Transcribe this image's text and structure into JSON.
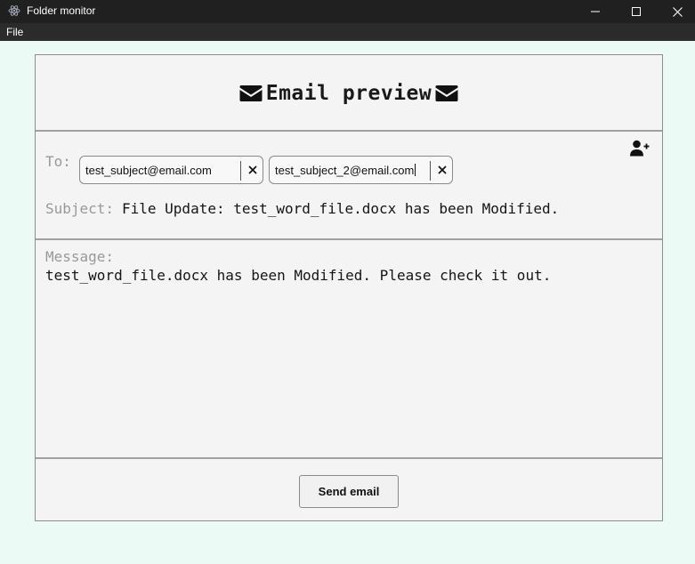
{
  "window": {
    "title": "Folder monitor",
    "app_icon": "electron-icon",
    "controls": {
      "minimize": "minimize-icon",
      "maximize": "maximize-icon",
      "close": "close-icon"
    }
  },
  "menubar": {
    "items": [
      {
        "label": "File"
      }
    ]
  },
  "card": {
    "header": {
      "title": "Email preview",
      "icon": "envelope-icon"
    },
    "recipients": {
      "to_label": "To:",
      "chips": [
        {
          "email": "test_subject@email.com",
          "clear_icon": "x-icon"
        },
        {
          "email": "test_subject_2@email.com",
          "clear_icon": "x-icon",
          "editing": true
        }
      ],
      "add_icon": "add-user-icon"
    },
    "subject": {
      "label": "Subject:",
      "value": "File Update: test_word_file.docx has been Modified."
    },
    "message": {
      "label": "Message:",
      "body": "test_word_file.docx has been Modified. Please check it out."
    },
    "footer": {
      "send_label": "Send email"
    }
  },
  "colors": {
    "background": "#ecfaf6",
    "titlebar": "#202020",
    "menubar": "#2b2b2b",
    "card": "#f4f4f4",
    "muted_label": "#999999"
  }
}
